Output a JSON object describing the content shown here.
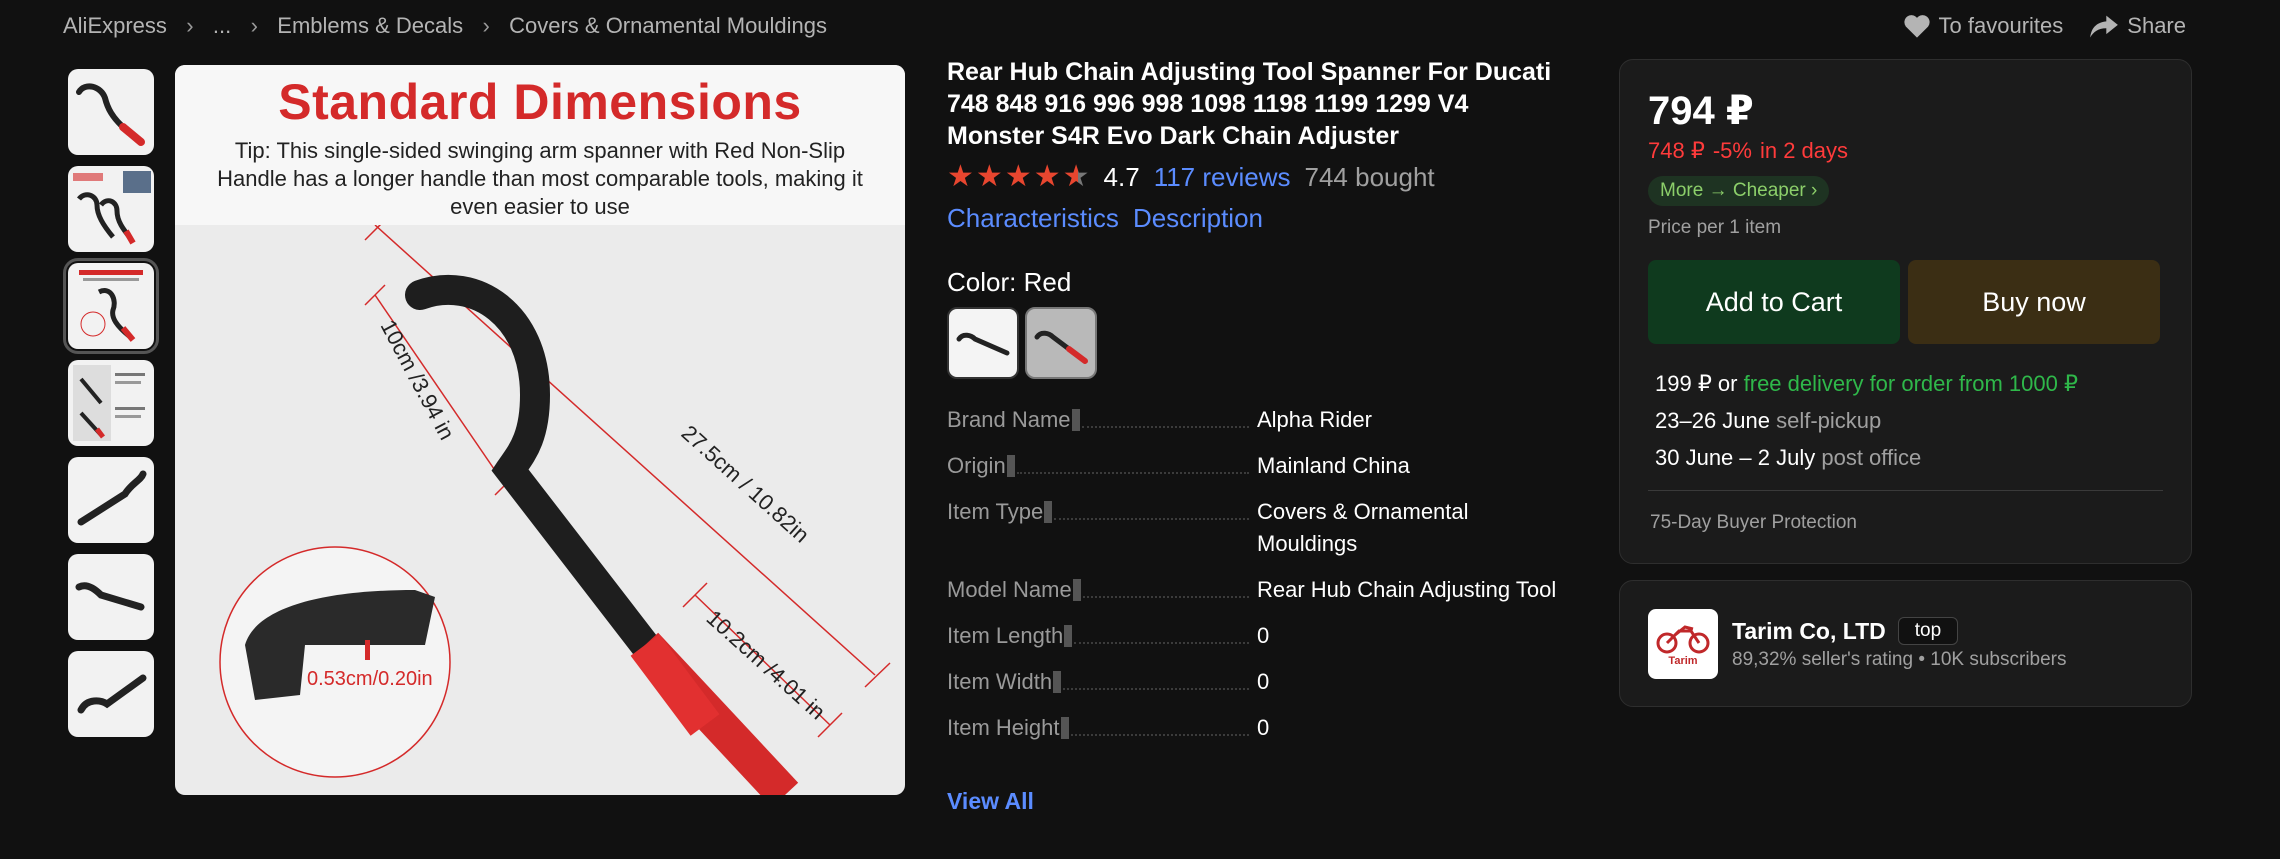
{
  "breadcrumb": [
    "AliExpress",
    "...",
    "Emblems & Decals",
    "Covers & Ornamental Mouldings"
  ],
  "top_actions": {
    "favourites": "To favourites",
    "share": "Share"
  },
  "image": {
    "title": "Standard Dimensions",
    "tip": "Tip: This single-sided swinging arm spanner with Red Non-Slip Handle has a longer handle than most comparable tools, making it even easier to use",
    "dim_1": "10cm /3.94 in",
    "dim_2": "27.5cm / 10.82in",
    "dim_3": "10.2cm /4.01 in",
    "dim_detail": "0.53cm/0.20in"
  },
  "product": {
    "title": "Rear Hub Chain Adjusting Tool Spanner For Ducati 748 848 916 996 998 1098 1198 1199 1299 V4 Monster S4R Evo Dark Chain Adjuster",
    "rating": "4.7",
    "reviews": "117 reviews",
    "bought": "744 bought",
    "link_characteristics": "Characteristics",
    "link_description": "Description",
    "color_label": "Color: Red",
    "specs": [
      {
        "key": "Brand Name",
        "value": "Alpha Rider"
      },
      {
        "key": "Origin",
        "value": "Mainland China"
      },
      {
        "key": "Item Type",
        "value": "Covers & Ornamental Mouldings"
      },
      {
        "key": "Model Name",
        "value": "Rear Hub Chain Adjusting Tool"
      },
      {
        "key": "Item Length",
        "value": "0"
      },
      {
        "key": "Item Width",
        "value": "0"
      },
      {
        "key": "Item Height",
        "value": "0"
      }
    ],
    "view_all": "View All"
  },
  "buy": {
    "price": "794 ₽",
    "old_price": "748 ₽",
    "discount": "-5%",
    "in_days": "in 2 days",
    "cheaper": "More → Cheaper",
    "per_item": "Price per 1 item",
    "add_to_cart": "Add to Cart",
    "buy_now": "Buy now",
    "delivery_price": "199 ₽ or",
    "free_delivery": "free delivery for order from 1000 ₽",
    "pickup_date": "23–26 June",
    "pickup_label": "self-pickup",
    "post_date": "30 June – 2 July",
    "post_label": "post office",
    "protection": "75-Day Buyer Protection"
  },
  "seller": {
    "logo_text": "Tarim",
    "name": "Tarim Co, LTD",
    "badge": "top",
    "meta": "89,32% seller's rating  •  10K subscribers"
  },
  "colors": {
    "accent_blue": "#5b8cff",
    "price_red": "#ff3b3b",
    "green": "#2fb84a",
    "star": "#e8462f"
  }
}
